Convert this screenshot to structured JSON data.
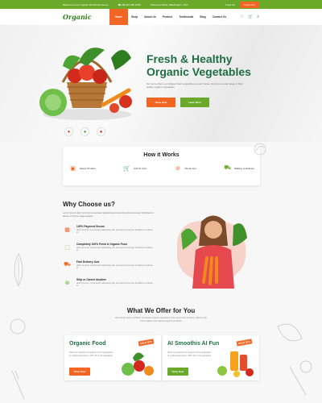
{
  "topbar": {
    "welcome": "Welcome to our organic WordPress theme",
    "phone": "+88 001 335 9756",
    "address": "Florence Plaza, Washington, USA",
    "track": "Track Us",
    "checkout": "Check Out"
  },
  "header": {
    "logo": "Organic",
    "nav": [
      "Home",
      "Shop",
      "About Us",
      "Product",
      "Testimonial",
      "Blog",
      "Contact Us"
    ],
    "icons": [
      "heart-icon",
      "cart-icon",
      "search-icon"
    ]
  },
  "hero": {
    "title_line1": "Fresh & Healthy",
    "title_line2": "Organic Vegetables",
    "desc": "Our store offers you always fresh vegetables at your house, buy from a wide range of high quality organic vegetables",
    "shop_btn": "Shop Now",
    "learn_btn": "Learn More"
  },
  "how": {
    "title": "How  it Works",
    "steps": [
      {
        "label": "Select Product",
        "icon": "product-box-icon"
      },
      {
        "label": "Add To Cart",
        "icon": "cart-icon"
      },
      {
        "label": "Check Out",
        "icon": "checkout-icon"
      },
      {
        "label": "Waiting to Delivery",
        "icon": "truck-icon"
      }
    ]
  },
  "why": {
    "title": "Why Choose us?",
    "intro": "Lorem ipsum dolor sit amet consectetur adipisicing elit sed do eiusmod tempor incididunt ut labore et dolore magna aliqua.",
    "features": [
      {
        "title": "100% Payment Secure",
        "desc": "dolor sit amet, consectetur adipisicing elit, sed eiusmod tempor incididunt ut labore et"
      },
      {
        "title": "Completely 100% Fresh & Organic Food",
        "desc": "dolor sit amet, consectetur adipisicing elit, sed eiusmod tempor incididunt ut labore et"
      },
      {
        "title": "Fast Delivery Just",
        "desc": "dolor sit amet, consectetur adipisicing elit, sed eiusmod tempor incididunt ut labore et"
      },
      {
        "title": "Ship or Cancel Anytime",
        "desc": "dolor sit amet, consectetur adipisicing elit, sed eiusmod tempor incididunt ut labore et"
      }
    ]
  },
  "offer": {
    "title": "What We Offer for You",
    "sub": "We extract layers of flavor of natural organic ingredients from your local orchard, offering the best organic and natural organic products",
    "cards": [
      {
        "title": "Organic Food",
        "desc": "Shop our selection of organic fruit & vegetables in a discounted price. 10% off on all vegetables",
        "btn": "Shop Now",
        "sale": "SALE 30%"
      },
      {
        "title": "AI Smoothis AI Fun",
        "desc": "Shop our selection of organic fruit & vegetables in a discounted price. 10% off on all vegetables",
        "btn": "Shop Now",
        "sale": "SALE 30%"
      }
    ]
  },
  "colors": {
    "green": "#6aa92a",
    "orange": "#f26522",
    "dark_green": "#1f6e43"
  }
}
